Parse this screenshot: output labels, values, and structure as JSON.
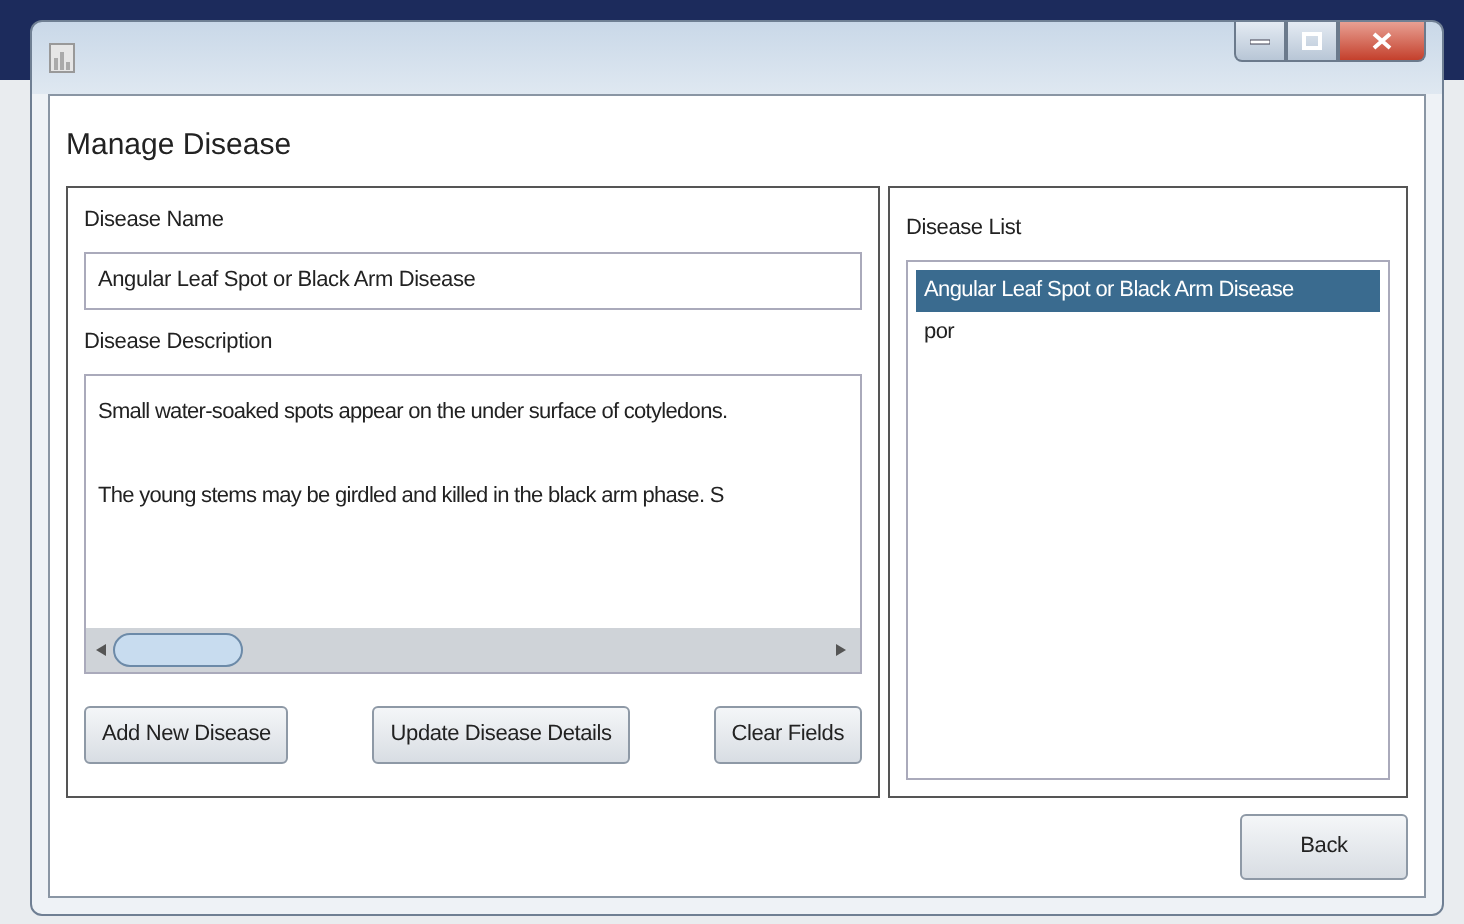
{
  "window": {
    "heading": "Manage Disease"
  },
  "details": {
    "name_label": "Disease Name",
    "name_value": "Angular Leaf Spot or Black Arm Disease",
    "description_label": "Disease Description",
    "description_lines": [
      "Small water-soaked spots appear on the under surface of cotyledons.",
      "The young stems may be girdled and killed in the black arm phase. S"
    ],
    "buttons": [
      "Add New Disease",
      "Update Disease Details",
      "Clear Fields"
    ]
  },
  "disease_list": {
    "label": "Disease List",
    "items": [
      {
        "text": "Angular Leaf Spot or Black Arm Disease",
        "selected": true
      },
      {
        "text": "por",
        "selected": false
      }
    ]
  },
  "back_button": "Back"
}
